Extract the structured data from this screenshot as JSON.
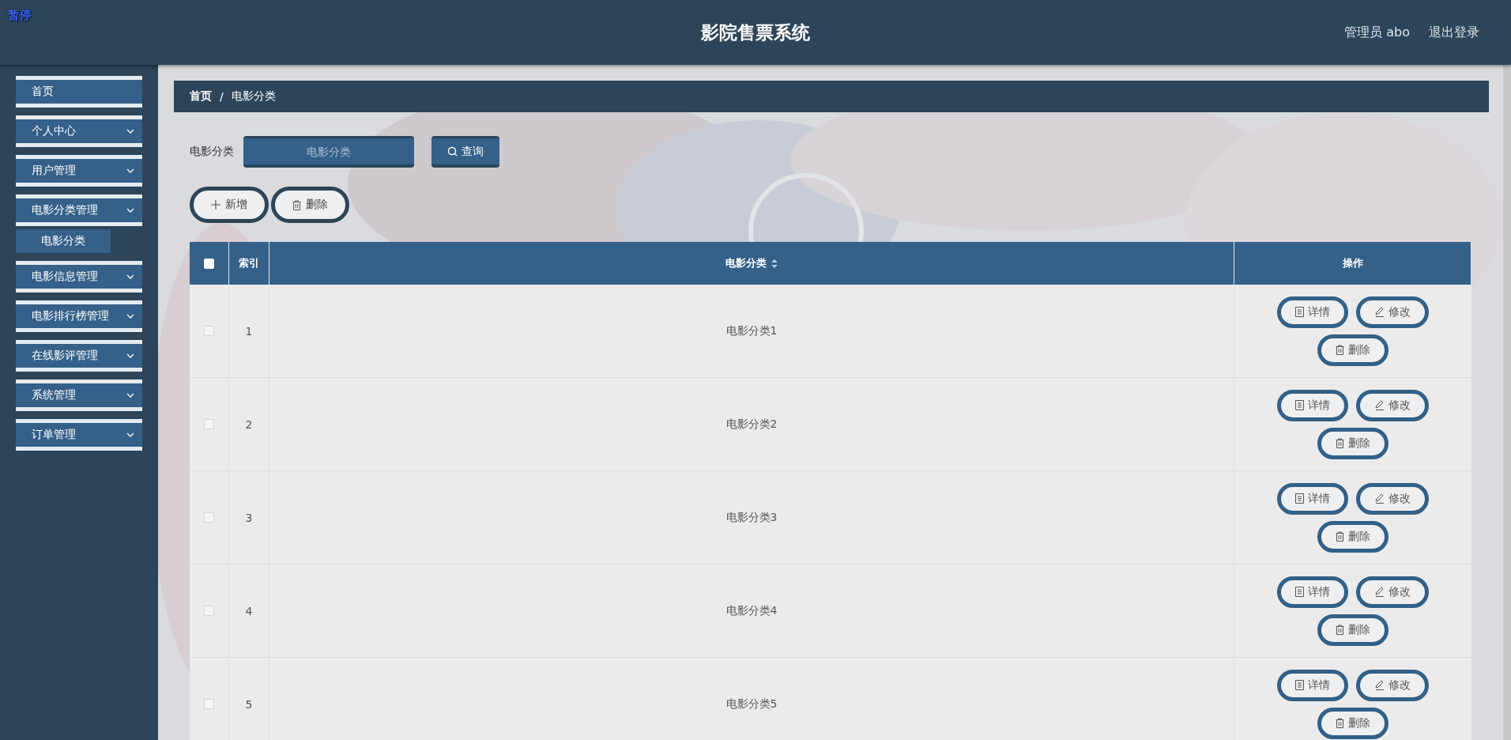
{
  "overlay_label": "暂停",
  "header": {
    "title": "影院售票系统",
    "user": "管理员 abo",
    "logout": "退出登录"
  },
  "sidebar": {
    "items": [
      {
        "label": "首页",
        "expandable": false
      },
      {
        "label": "个人中心",
        "expandable": true
      },
      {
        "label": "用户管理",
        "expandable": true
      },
      {
        "label": "电影分类管理",
        "expandable": true,
        "children": [
          {
            "label": "电影分类",
            "selected": true
          }
        ]
      },
      {
        "label": "电影信息管理",
        "expandable": true
      },
      {
        "label": "电影排行榜管理",
        "expandable": true
      },
      {
        "label": "在线影评管理",
        "expandable": true
      },
      {
        "label": "系统管理",
        "expandable": true
      },
      {
        "label": "订单管理",
        "expandable": true
      }
    ]
  },
  "breadcrumb": {
    "items": [
      "首页",
      "电影分类"
    ],
    "separator": "/"
  },
  "search": {
    "label": "电影分类",
    "placeholder": "电影分类",
    "button": "查询"
  },
  "actions": [
    {
      "kind": "add",
      "label": "新增"
    },
    {
      "kind": "delete",
      "label": "删除"
    }
  ],
  "table": {
    "select_all_checked": false,
    "columns": [
      {
        "label": "索引",
        "sortable": false
      },
      {
        "label": "电影分类",
        "sortable": true
      },
      {
        "label": "操作",
        "sortable": false
      }
    ],
    "rows": [
      {
        "checked": false,
        "index": "1",
        "category": "电影分类1",
        "buttons": [
          {
            "kind": "detail",
            "label": "详情"
          },
          {
            "kind": "edit",
            "label": "修改"
          },
          {
            "kind": "delete",
            "label": "删除"
          }
        ]
      },
      {
        "checked": false,
        "index": "2",
        "category": "电影分类2",
        "buttons": [
          {
            "kind": "detail",
            "label": "详情"
          },
          {
            "kind": "edit",
            "label": "修改"
          },
          {
            "kind": "delete",
            "label": "删除"
          }
        ]
      },
      {
        "checked": false,
        "index": "3",
        "category": "电影分类3",
        "buttons": [
          {
            "kind": "detail",
            "label": "详情"
          },
          {
            "kind": "edit",
            "label": "修改"
          },
          {
            "kind": "delete",
            "label": "删除"
          }
        ]
      },
      {
        "checked": false,
        "index": "4",
        "category": "电影分类4",
        "buttons": [
          {
            "kind": "detail",
            "label": "详情"
          },
          {
            "kind": "edit",
            "label": "修改"
          },
          {
            "kind": "delete",
            "label": "删除"
          }
        ]
      },
      {
        "checked": false,
        "index": "5",
        "category": "电影分类5",
        "buttons": [
          {
            "kind": "detail",
            "label": "详情"
          },
          {
            "kind": "edit",
            "label": "修改"
          },
          {
            "kind": "delete",
            "label": "删除"
          }
        ]
      }
    ]
  }
}
